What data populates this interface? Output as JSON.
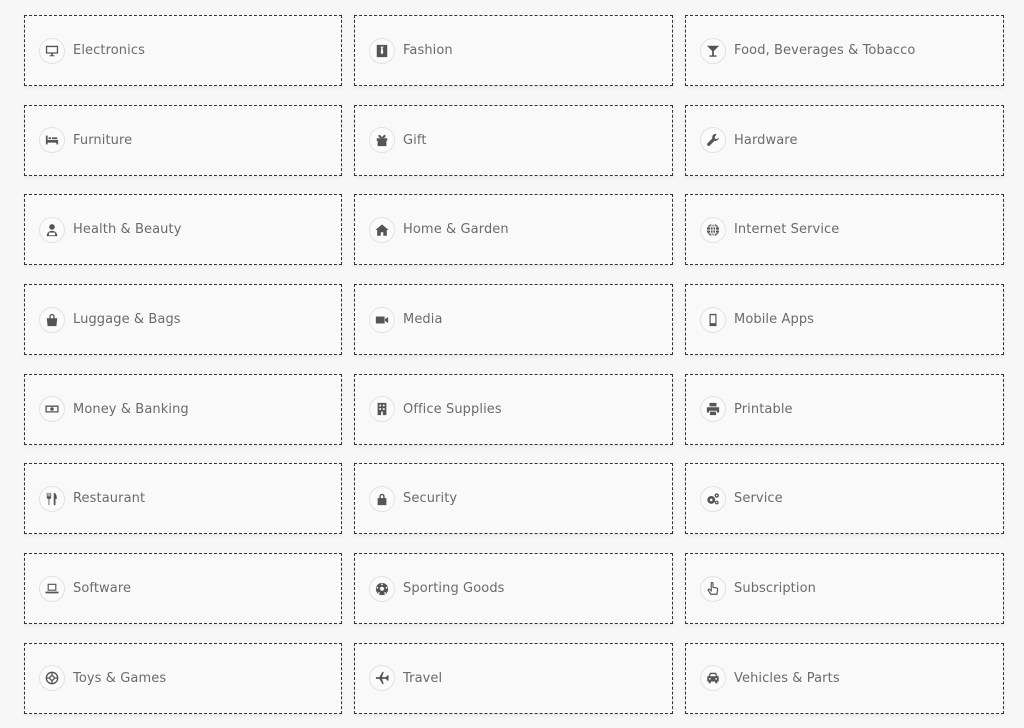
{
  "categories": [
    {
      "label": "Electronics",
      "icon": "desktop-icon"
    },
    {
      "label": "Fashion",
      "icon": "tie-icon"
    },
    {
      "label": "Food, Beverages & Tobacco",
      "icon": "cocktail-glass-icon"
    },
    {
      "label": "Furniture",
      "icon": "bed-icon"
    },
    {
      "label": "Gift",
      "icon": "gift-icon"
    },
    {
      "label": "Hardware",
      "icon": "wrench-icon"
    },
    {
      "label": "Health & Beauty",
      "icon": "user-doctor-icon"
    },
    {
      "label": "Home & Garden",
      "icon": "home-icon"
    },
    {
      "label": "Internet Service",
      "icon": "globe-icon"
    },
    {
      "label": "Luggage & Bags",
      "icon": "shopping-bag-icon"
    },
    {
      "label": "Media",
      "icon": "video-camera-icon"
    },
    {
      "label": "Mobile Apps",
      "icon": "mobile-phone-icon"
    },
    {
      "label": "Money & Banking",
      "icon": "money-bill-icon"
    },
    {
      "label": "Office Supplies",
      "icon": "building-icon"
    },
    {
      "label": "Printable",
      "icon": "print-icon"
    },
    {
      "label": "Restaurant",
      "icon": "cutlery-icon"
    },
    {
      "label": "Security",
      "icon": "lock-icon"
    },
    {
      "label": "Service",
      "icon": "cogs-icon"
    },
    {
      "label": "Software",
      "icon": "laptop-icon"
    },
    {
      "label": "Sporting Goods",
      "icon": "soccer-ball-icon"
    },
    {
      "label": "Subscription",
      "icon": "hand-pointer-icon"
    },
    {
      "label": "Toys & Games",
      "icon": "life-ring-icon"
    },
    {
      "label": "Travel",
      "icon": "plane-icon"
    },
    {
      "label": "Vehicles & Parts",
      "icon": "car-icon"
    }
  ]
}
